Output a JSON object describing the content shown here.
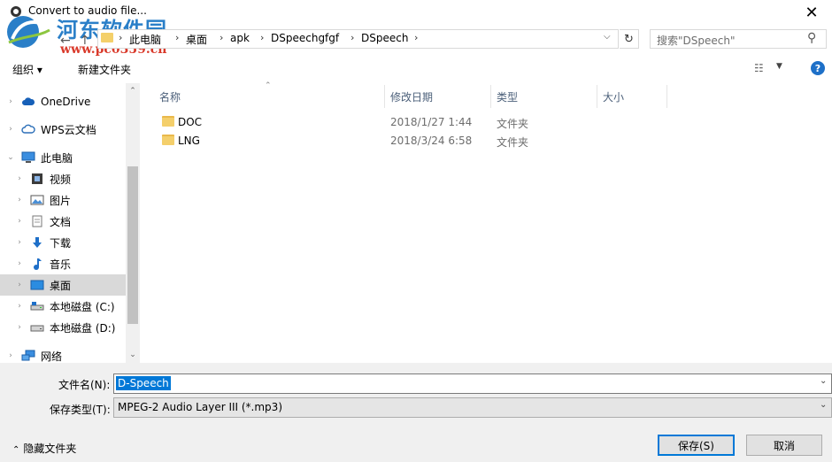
{
  "window": {
    "title": "Convert to audio file...",
    "close_glyph": "✕"
  },
  "watermark": {
    "title": "河东软件园",
    "url": "www.pc0359.cn"
  },
  "address": {
    "breadcrumb": [
      "此电脑",
      "桌面",
      "apk",
      "DSpeechgfgf",
      "DSpeech"
    ],
    "separator": "›"
  },
  "search": {
    "placeholder": "搜索\"DSpeech\""
  },
  "toolbar": {
    "organize_label": "组织 ▾",
    "new_folder_label": "新建文件夹",
    "help_glyph": "?"
  },
  "nav": {
    "items": [
      {
        "label": "OneDrive",
        "icon": "cloud-icon"
      },
      {
        "label": "WPS云文档",
        "icon": "cloud-outline-icon"
      },
      {
        "label": "此电脑",
        "icon": "computer-icon"
      },
      {
        "label": "视频",
        "icon": "video-icon"
      },
      {
        "label": "图片",
        "icon": "picture-icon"
      },
      {
        "label": "文档",
        "icon": "document-icon"
      },
      {
        "label": "下载",
        "icon": "download-icon"
      },
      {
        "label": "音乐",
        "icon": "music-icon"
      },
      {
        "label": "桌面",
        "icon": "desktop-icon",
        "selected": true
      },
      {
        "label": "本地磁盘 (C:)",
        "icon": "drive-c-icon"
      },
      {
        "label": "本地磁盘 (D:)",
        "icon": "drive-d-icon"
      },
      {
        "label": "网络",
        "icon": "network-icon"
      }
    ]
  },
  "filelist": {
    "columns": [
      "名称",
      "修改日期",
      "类型",
      "大小"
    ],
    "rows": [
      {
        "name": "DOC",
        "modified": "2018/1/27 1:44",
        "type": "文件夹",
        "size": ""
      },
      {
        "name": "LNG",
        "modified": "2018/3/24 6:58",
        "type": "文件夹",
        "size": ""
      }
    ]
  },
  "save_form": {
    "filename_label": "文件名(N):",
    "filename_value": "D-Speech",
    "filetype_label": "保存类型(T):",
    "filetype_value": "MPEG-2 Audio Layer III (*.mp3)",
    "hide_folders_label": "隐藏文件夹",
    "save_label": "保存(S)",
    "cancel_label": "取消"
  },
  "colors": {
    "accent": "#0078d7",
    "selection": "#d9d9d9",
    "folder": "#f4cf6b",
    "watermark_blue": "#2a7fc8",
    "watermark_red": "#d93a2b"
  }
}
